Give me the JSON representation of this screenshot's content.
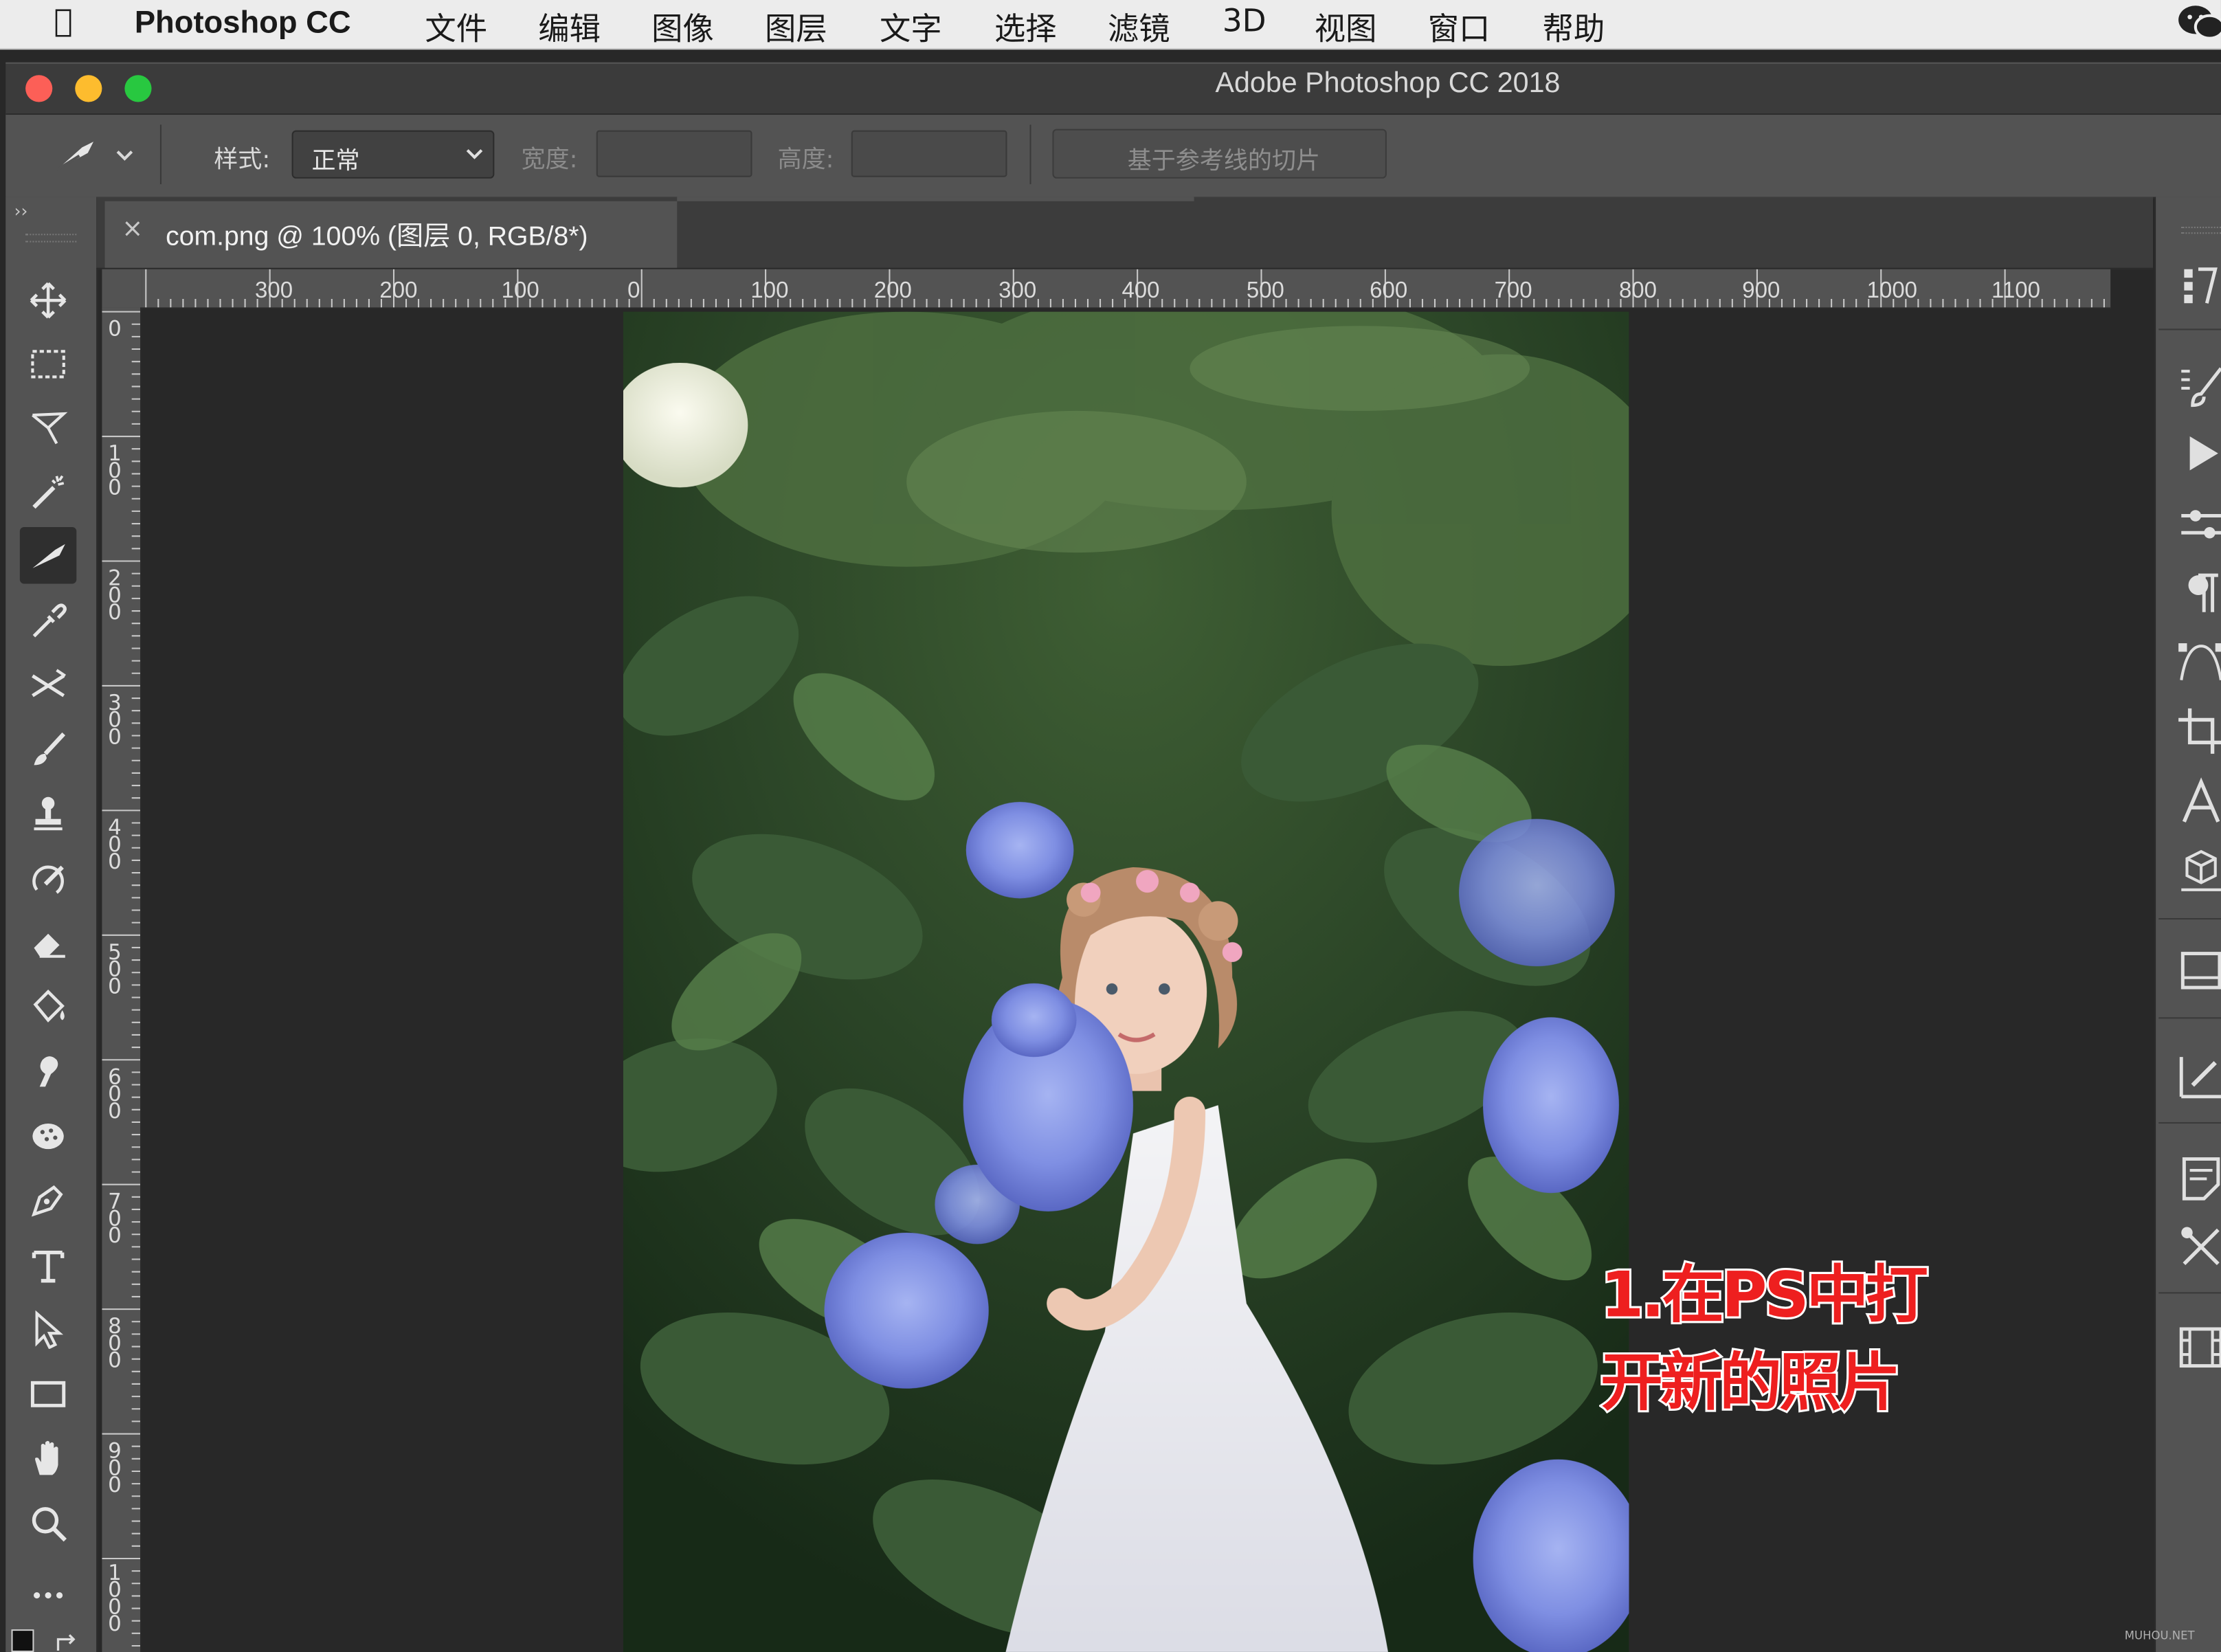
{
  "menubar": {
    "app_name": "Photoshop CC",
    "items": [
      "文件",
      "编辑",
      "图像",
      "图层",
      "文字",
      "选择",
      "滤镜",
      "3D",
      "视图",
      "窗口",
      "帮助"
    ]
  },
  "window": {
    "title": "Adobe Photoshop CC 2018"
  },
  "options_bar": {
    "style_label": "样式:",
    "style_value": "正常",
    "width_label": "宽度:",
    "height_label": "高度:",
    "guides_button": "基于参考线的切片"
  },
  "document_tab": {
    "close": "×",
    "title": "com.png @ 100% (图层 0, RGB/8*)"
  },
  "ruler": {
    "horizontal": [
      "300",
      "200",
      "100",
      "0",
      "100",
      "200",
      "300",
      "400",
      "500",
      "600",
      "700",
      "800",
      "900",
      "1000",
      "1100"
    ],
    "vertical": [
      "0",
      "100",
      "200",
      "300",
      "400",
      "500",
      "600",
      "700",
      "800",
      "900",
      "1000"
    ]
  },
  "tools": [
    "move-tool",
    "marquee-tool",
    "lasso-tool",
    "magic-wand-tool",
    "slice-tool",
    "eyedropper-tool",
    "healing-tool",
    "brush-tool",
    "stamp-tool",
    "history-brush-tool",
    "eraser-tool",
    "paint-bucket-tool",
    "smudge-tool",
    "sponge-tool",
    "pen-tool",
    "type-tool",
    "path-selection-tool",
    "rectangle-tool",
    "hand-tool",
    "zoom-tool",
    "more-tools"
  ],
  "active_tool": "slice-tool",
  "annotation": {
    "line1": "1.在PS中打",
    "line2": "开新的照片"
  },
  "watermark": "MUHOU.NET",
  "colors": {
    "annotation_red": "#ee1f1f",
    "panel_gray": "#535353",
    "canvas_bg": "#282828"
  }
}
